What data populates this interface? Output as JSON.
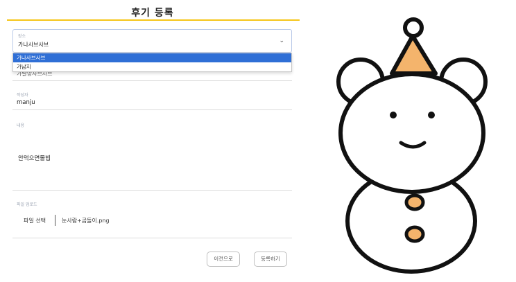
{
  "page": {
    "title": "후기 등록"
  },
  "place": {
    "label": "장소",
    "value": "가나사브사브",
    "options": [
      "가나사브사브",
      "가남지"
    ],
    "hidden_value": "가랄망사브사브"
  },
  "author": {
    "label": "작성자",
    "value": "manju"
  },
  "content": {
    "label": "내용",
    "value": "안먹으면몰빕"
  },
  "upload": {
    "label": "파일 업로드",
    "button_label": "파일 선택",
    "file_name": "눈사람+곰돌이.png"
  },
  "actions": {
    "prev_label": "이전으로",
    "submit_label": "등록하기"
  },
  "colors": {
    "accent": "#f5c518",
    "selected": "#2f6fd6",
    "hat": "#f4b46c"
  },
  "illustration": {
    "name": "snowman-bear-icon"
  }
}
